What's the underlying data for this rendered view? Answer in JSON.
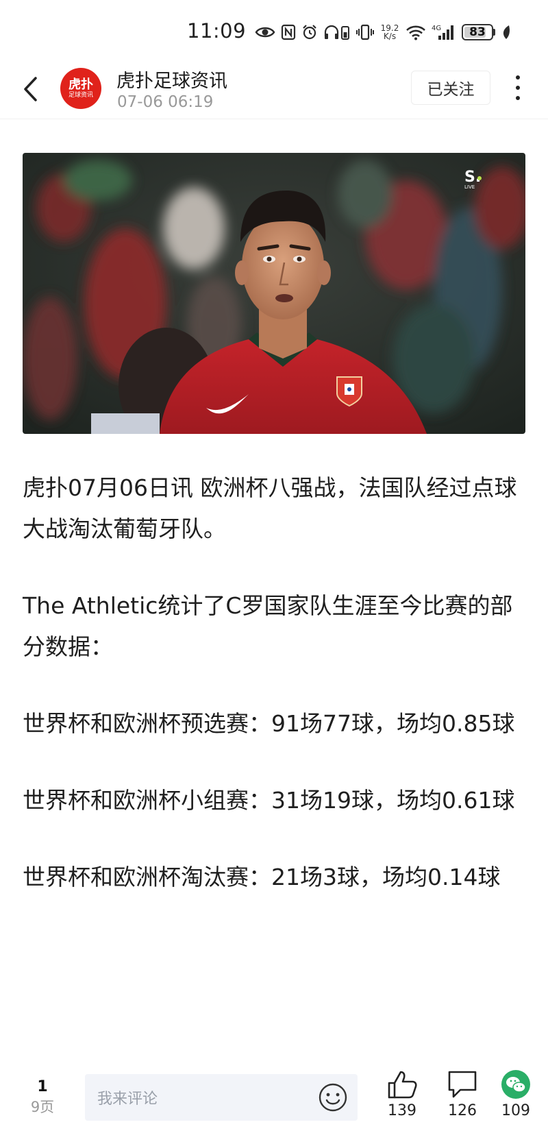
{
  "status_bar": {
    "time": "11:09",
    "net_speed_value": "19.2",
    "net_speed_unit": "K/s",
    "network_type": "4G",
    "battery_level": "83",
    "icons": [
      "eye-icon",
      "nfc-icon",
      "alarm-icon",
      "headphone-battery-icon",
      "vibrate-icon",
      "wifi-icon",
      "signal-icon",
      "battery-icon",
      "leaf-icon"
    ]
  },
  "header": {
    "source_name": "虎扑足球资讯",
    "publish_time": "07-06 06:19",
    "avatar_text_main": "虎扑",
    "avatar_text_sub": "足球资讯",
    "follow_label": "已关注"
  },
  "hero_image": {
    "description": "Portugal player in red jersey during match",
    "watermark": "S.",
    "watermark_sub": "LIVE"
  },
  "article": {
    "paragraphs": [
      "虎扑07月06日讯 欧洲杯八强战，法国队经过点球大战淘汰葡萄牙队。",
      "The Athletic统计了C罗国家队生涯至今比赛的部分数据：",
      "世界杯和欧洲杯预选赛：91场77球，场均0.85球",
      "世界杯和欧洲杯小组赛：31场19球，场均0.61球",
      "世界杯和欧洲杯淘汰赛：21场3球，场均0.14球"
    ]
  },
  "bottom_bar": {
    "page_current": "1",
    "page_total": "9页",
    "comment_placeholder": "我来评论",
    "like_count": "139",
    "comment_count": "126",
    "share_count": "109"
  }
}
